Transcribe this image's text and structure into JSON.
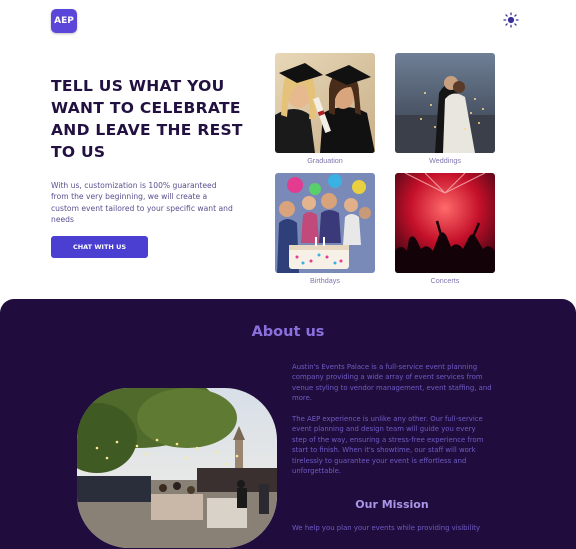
{
  "header": {
    "logo_text": "AEP",
    "theme_icon": "sun-icon"
  },
  "hero": {
    "title": "TELL US WHAT YOU WANT TO CELEBRATE AND LEAVE THE REST TO US",
    "description": "With us, customization is 100% guaranteed from the very beginning, we will create a custom event tailored to your specific want and needs",
    "cta_label": "CHAT WITH US"
  },
  "gallery": [
    {
      "caption": "Graduation"
    },
    {
      "caption": "Weddings"
    },
    {
      "caption": "Birthdays"
    },
    {
      "caption": "Concerts"
    }
  ],
  "about": {
    "title": "About us",
    "paragraph1": "Austin's Events Palace is a full-service event planning company providing a wide array of event services from venue styling to vendor management, event staffing, and more.",
    "paragraph2": "The AEP experience is unlike any other. Our full-service event planning and design team will guide you every step of the way, ensuring a stress-free experience from start to finish. When it's showtime, our staff will work tirelessly to guarantee your event is effortless and unforgettable.",
    "mission_title": "Our Mission",
    "mission_text": "We help you plan your events while providing visibility"
  },
  "colors": {
    "accent": "#4b3fd1",
    "dark_section": "#200d3d",
    "heading_text": "#221040"
  }
}
